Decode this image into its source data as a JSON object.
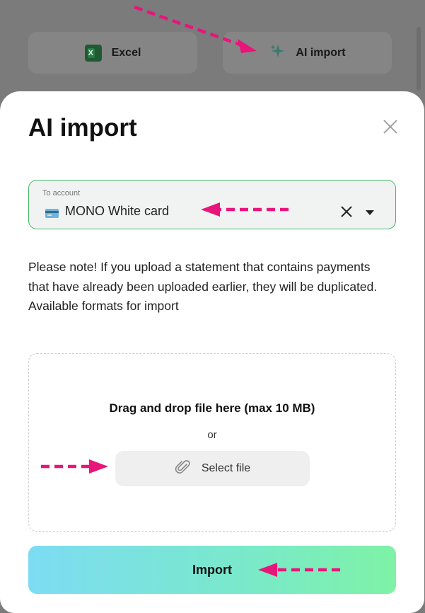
{
  "background": {
    "buttons": [
      {
        "label": "Excel",
        "icon": "excel-icon"
      },
      {
        "label": "AI import",
        "icon": "sparkle-icon"
      }
    ]
  },
  "modal": {
    "title": "AI import",
    "close_icon": "close-icon",
    "account": {
      "label": "To account",
      "value": "MONO White card",
      "icon": "card-icon"
    },
    "note": "Please note! If you upload a statement that contains payments that have already been uploaded earlier, they will be duplicated. Available formats for import",
    "dropzone": {
      "title": "Drag and drop file here (max 10 MB)",
      "or": "or",
      "select_label": "Select file",
      "select_icon": "paperclip-icon"
    },
    "import_label": "Import"
  },
  "colors": {
    "accent_border": "#46b866",
    "annotation_arrow": "#e8157a",
    "import_gradient": [
      "#7ddcf3",
      "#7ff2a6"
    ]
  }
}
